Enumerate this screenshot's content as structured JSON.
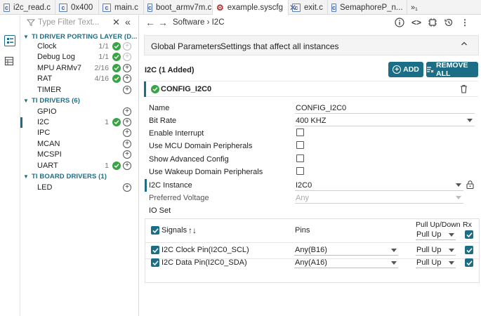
{
  "tabs": [
    {
      "label": "i2c_read.c",
      "icon": "c-file-icon",
      "active": false
    },
    {
      "label": "0x400",
      "icon": "c-file-icon",
      "active": false
    },
    {
      "label": "main.c",
      "icon": "c-file-icon",
      "active": false
    },
    {
      "label": "boot_armv7m.c",
      "icon": "c-file-icon",
      "active": false
    },
    {
      "label": "example.syscfg",
      "icon": "syscfg-file-icon",
      "active": true,
      "close": "✕"
    },
    {
      "label": "exit.c",
      "icon": "c-file-icon",
      "active": false
    },
    {
      "label": "SemaphoreP_n...",
      "icon": "c-file-icon",
      "active": false
    },
    {
      "label": "»₁",
      "icon": "",
      "active": false
    }
  ],
  "filter": {
    "placeholder": "Type Filter Text..."
  },
  "tree": {
    "group1": {
      "label": "TI DRIVER PORTING LAYER (D..."
    },
    "group2": {
      "label": "TI DRIVERS (6)"
    },
    "group3": {
      "label": "TI BOARD DRIVERS (1)"
    },
    "items": [
      {
        "label": "Clock",
        "count": "1/1",
        "ok": true,
        "add_enabled": false
      },
      {
        "label": "Debug Log",
        "count": "1/1",
        "ok": true,
        "add_enabled": false
      },
      {
        "label": "MPU ARMv7",
        "count": "2/16",
        "ok": true,
        "add_enabled": true
      },
      {
        "label": "RAT",
        "count": "4/16",
        "ok": true,
        "add_enabled": true
      },
      {
        "label": "TIMER",
        "count": "",
        "ok": false,
        "add_enabled": true
      },
      {
        "label": "GPIO",
        "count": "",
        "ok": false,
        "add_enabled": true
      },
      {
        "label": "I2C",
        "count": "1",
        "ok": true,
        "add_enabled": true,
        "selected": true
      },
      {
        "label": "IPC",
        "count": "",
        "ok": false,
        "add_enabled": true
      },
      {
        "label": "MCAN",
        "count": "",
        "ok": false,
        "add_enabled": true
      },
      {
        "label": "MCSPI",
        "count": "",
        "ok": false,
        "add_enabled": true
      },
      {
        "label": "UART",
        "count": "1",
        "ok": true,
        "add_enabled": true
      },
      {
        "label": "LED",
        "count": "",
        "ok": false,
        "add_enabled": true
      }
    ]
  },
  "breadcrumb": {
    "path": "Software  ›  I2C"
  },
  "global_params": {
    "title": "Global Parameters",
    "subtitle": "Settings that affect all instances"
  },
  "module": {
    "added_label": "I2C (1 Added)",
    "add_button": "ADD",
    "remove_all_button": "REMOVE ALL"
  },
  "instance": {
    "name": "CONFIG_I2C0"
  },
  "config": {
    "name": {
      "label": "Name",
      "value": "CONFIG_I2C0"
    },
    "bit_rate": {
      "label": "Bit Rate",
      "value": "400 KHZ"
    },
    "enable_interrupt": {
      "label": "Enable Interrupt",
      "checked": false
    },
    "use_mcu_domain": {
      "label": "Use MCU Domain Peripherals",
      "checked": false
    },
    "show_advanced": {
      "label": "Show Advanced Config",
      "checked": false
    },
    "use_wakeup": {
      "label": "Use Wakeup Domain Peripherals",
      "checked": false
    },
    "i2c_instance": {
      "label": "I2C Instance",
      "value": "I2C0"
    },
    "preferred_voltage": {
      "label": "Preferred Voltage",
      "value": "Any"
    },
    "io_set": {
      "label": "IO Set"
    }
  },
  "signals": {
    "header": {
      "signals": "Signals",
      "pins": "Pins",
      "pull": "Pull Up/Down",
      "rx": "Rx",
      "pull_all": "Pull Up"
    },
    "rows": [
      {
        "name": "I2C Clock Pin(I2C0_SCL)",
        "pin": "Any(B16)",
        "pull": "Pull Up",
        "rx": true
      },
      {
        "name": "I2C Data Pin(I2C0_SDA)",
        "pin": "Any(A16)",
        "pull": "Pull Up",
        "rx": true
      }
    ]
  },
  "colors": {
    "accent": "#1c6e86",
    "ok": "#3aa346"
  }
}
